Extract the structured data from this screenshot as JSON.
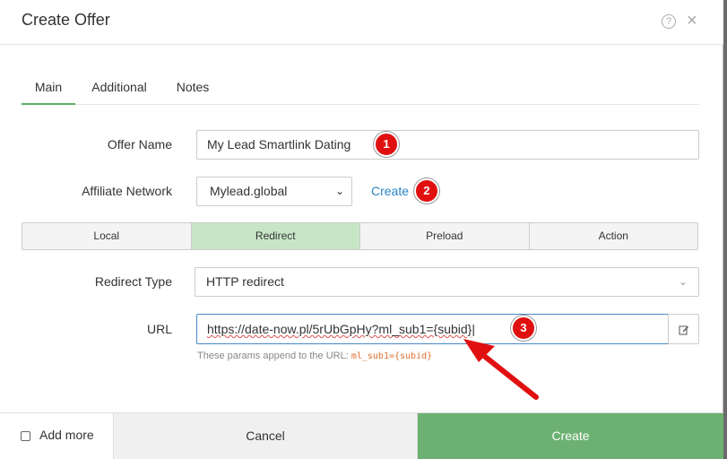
{
  "dialog": {
    "title": "Create Offer",
    "help_icon": "?",
    "close_icon": "×"
  },
  "tabs": [
    {
      "label": "Main",
      "active": true
    },
    {
      "label": "Additional",
      "active": false
    },
    {
      "label": "Notes",
      "active": false
    }
  ],
  "form": {
    "offer_name_label": "Offer Name",
    "offer_name_value": "My Lead Smartlink Dating",
    "affiliate_network_label": "Affiliate Network",
    "affiliate_network_value": "Mylead.global",
    "affiliate_network_create": "Create",
    "offer_modes": [
      {
        "label": "Local",
        "active": false
      },
      {
        "label": "Redirect",
        "active": true
      },
      {
        "label": "Preload",
        "active": false
      },
      {
        "label": "Action",
        "active": false
      }
    ],
    "redirect_type_label": "Redirect Type",
    "redirect_type_value": "HTTP redirect",
    "url_label": "URL",
    "url_value": "https://date-now.pl/5rUbGpHy?ml_sub1={subid}",
    "hint_text": "These params append to the URL:",
    "hint_code": "ml_sub1={subid}"
  },
  "annotations": {
    "badge_1": "1",
    "badge_2": "2",
    "badge_3": "3",
    "arrow_color": "#e11010"
  },
  "footer": {
    "add_more_label": "Add more",
    "cancel_label": "Cancel",
    "create_label": "Create"
  },
  "colors": {
    "accent_green": "#6cb171",
    "active_segment": "#c7e6c6",
    "link_blue": "#2a86c6",
    "hint_code": "#e0702c"
  }
}
